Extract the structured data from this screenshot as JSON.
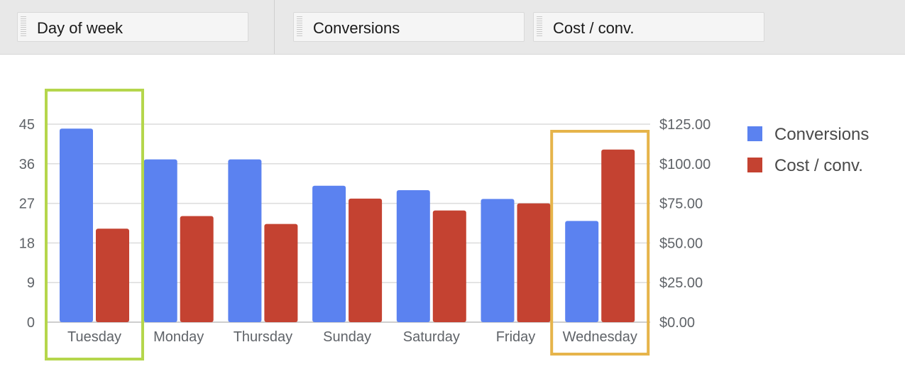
{
  "toolbar": {
    "dimension_pill": "Day of week",
    "metric_pill_1": "Conversions",
    "metric_pill_2": "Cost / conv."
  },
  "colors": {
    "conversions": "#5b82f0",
    "cost": "#c44231",
    "highlight_best": "#b5d64c",
    "highlight_worst": "#e6b44a",
    "grid": "#dcdcdc"
  },
  "chart_data": {
    "type": "bar",
    "categories": [
      "Tuesday",
      "Monday",
      "Thursday",
      "Sunday",
      "Saturday",
      "Friday",
      "Wednesday"
    ],
    "series": [
      {
        "name": "Conversions",
        "axis": "left",
        "values": [
          44,
          37,
          37,
          31,
          30,
          28,
          23
        ]
      },
      {
        "name": "Cost / conv.",
        "axis": "right",
        "values": [
          59,
          67,
          62,
          78,
          70.5,
          75,
          109
        ]
      }
    ],
    "left_axis": {
      "ticks": [
        "0",
        "9",
        "18",
        "27",
        "36",
        "45"
      ],
      "ylim": [
        0,
        45
      ]
    },
    "right_axis": {
      "ticks": [
        "$0.00",
        "$25.00",
        "$50.00",
        "$75.00",
        "$100.00",
        "$125.00"
      ],
      "ylim": [
        0,
        125
      ]
    },
    "grid": true,
    "legend": "right",
    "highlights": [
      {
        "category": "Tuesday",
        "color": "highlight_best"
      },
      {
        "category": "Wednesday",
        "color": "highlight_worst"
      }
    ]
  }
}
